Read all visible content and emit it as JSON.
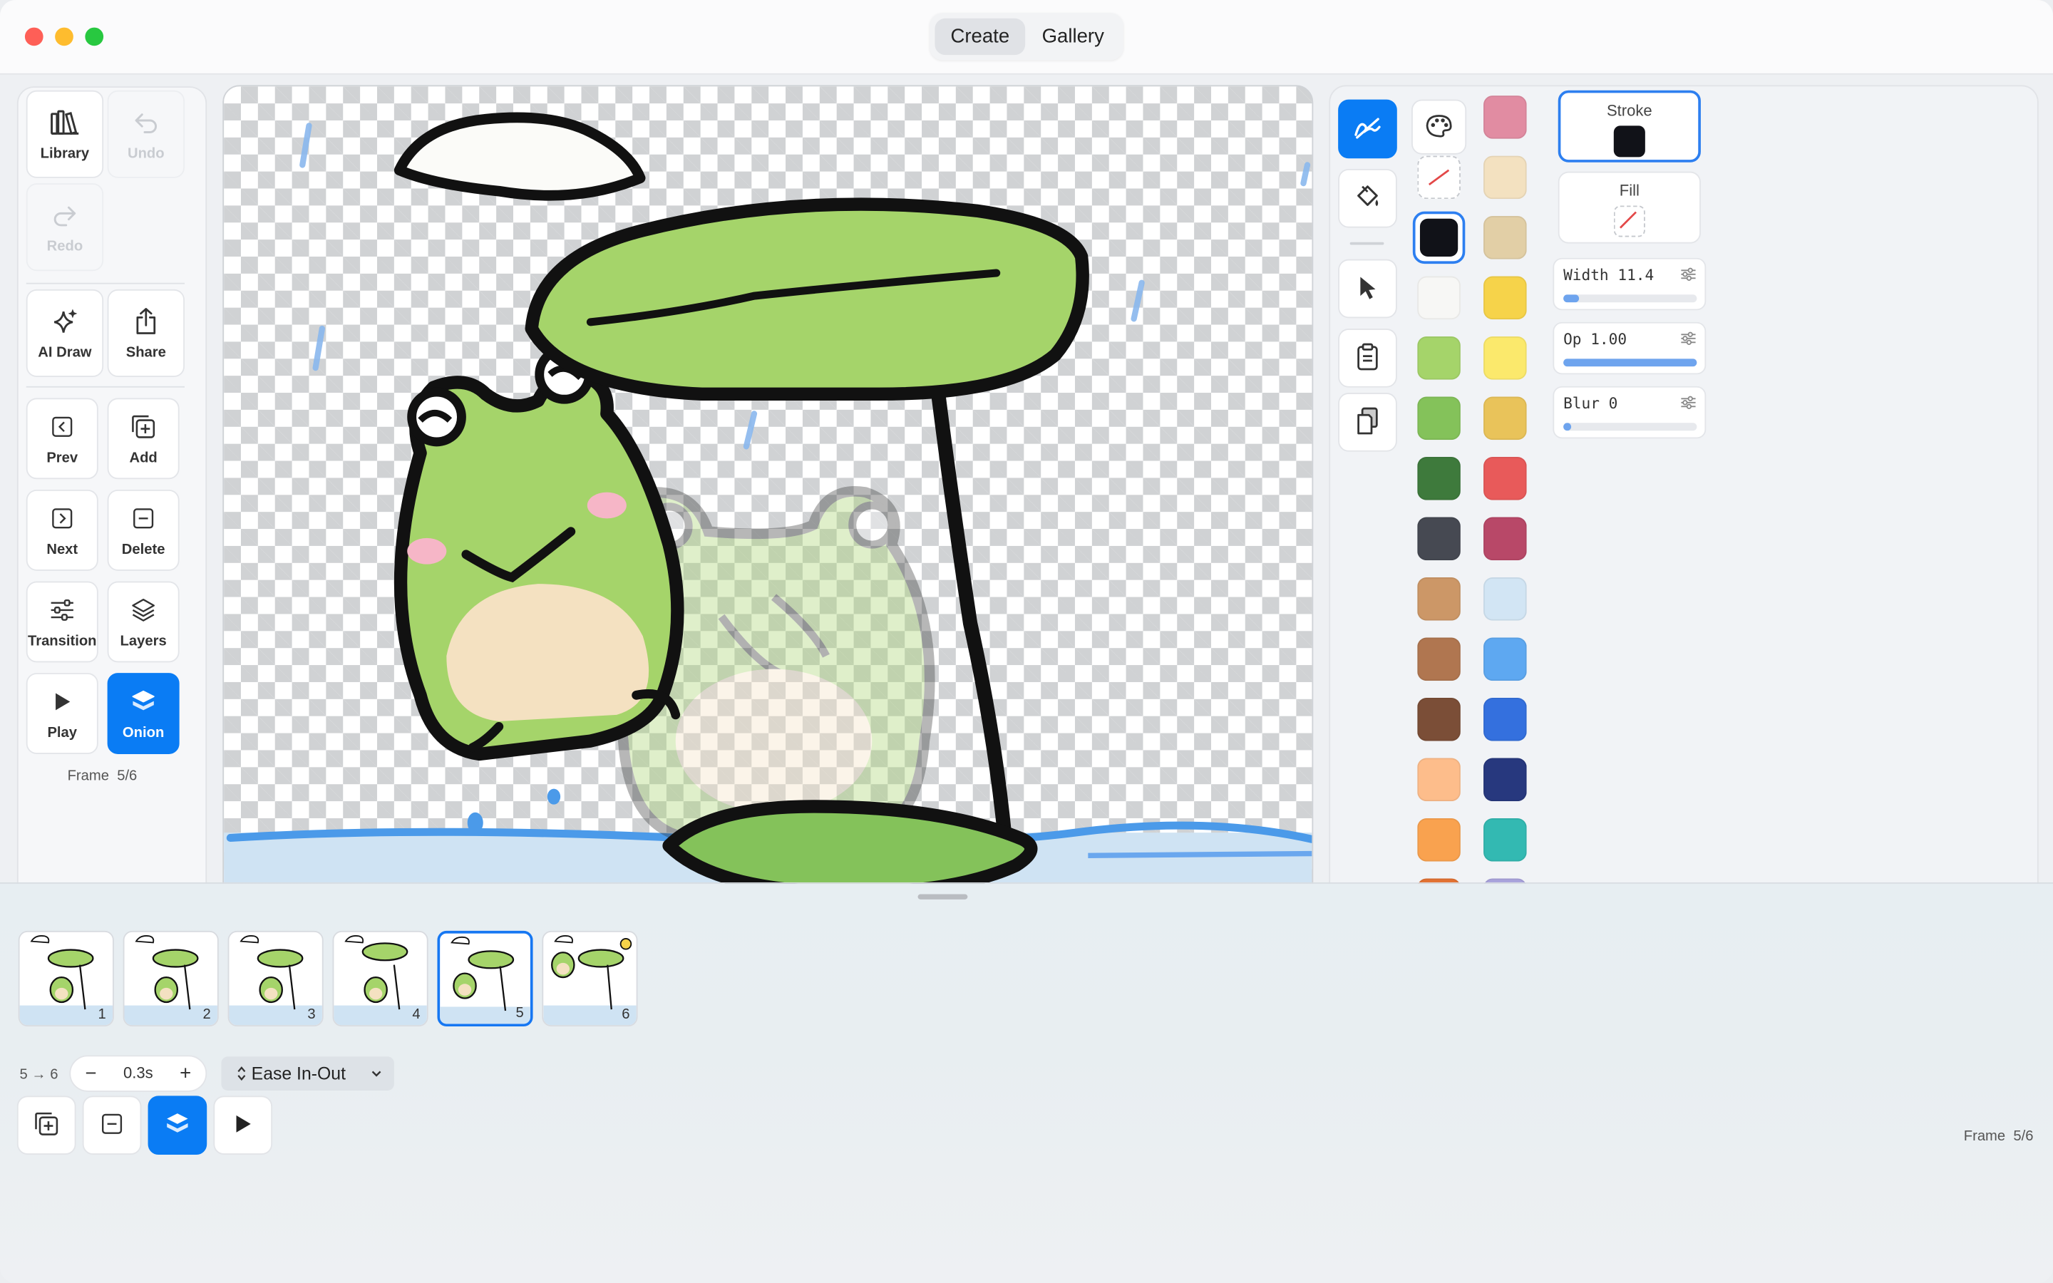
{
  "titlebar": {
    "tabs": [
      {
        "label": "Create",
        "active": true
      },
      {
        "label": "Gallery",
        "active": false
      }
    ]
  },
  "left_tools": {
    "library": "Library",
    "undo": "Undo",
    "redo": "Redo",
    "ai_draw": "AI Draw",
    "share": "Share",
    "prev": "Prev",
    "add": "Add",
    "next": "Next",
    "delete": "Delete",
    "transition": "Transition",
    "layers": "Layers",
    "play": "Play",
    "onion": "Onion",
    "frame_label": "Frame",
    "frame_value": "5/6"
  },
  "right_panel": {
    "tools": [
      "pen-icon",
      "palette-icon",
      "fill-bucket-icon",
      "pointer-icon",
      "clipboard-icon",
      "paste-icon"
    ],
    "swatches_col1": [
      "none",
      "#111218",
      "#f7f7f5",
      "#a5d46a",
      "#84c25a",
      "#3e7a3c",
      "#464952",
      "#cc9767",
      "#b07650",
      "#7b4e37",
      "#fdbd8b",
      "#f9a24f",
      "#e27132"
    ],
    "swatches_col2": [
      "#e18ca2",
      "#f3e1c0",
      "#e2cfa6",
      "#f6d34a",
      "#fbe96c",
      "#e9c35a",
      "#e85a5a",
      "#b84868",
      "#d2e5f4",
      "#5ea8f1",
      "#3470de",
      "#27387e",
      "#33b9b2",
      "#a9a3dc"
    ],
    "stroke": {
      "label": "Stroke",
      "color": "#111218"
    },
    "fill": {
      "label": "Fill",
      "color": "none"
    },
    "width": {
      "label": "Width 11.4",
      "value": 0.12
    },
    "opacity": {
      "label": "Op 1.00",
      "value": 1.0
    },
    "blur": {
      "label": "Blur 0",
      "value": 0.06
    }
  },
  "timeline": {
    "frames": [
      "1",
      "2",
      "3",
      "4",
      "5",
      "6"
    ],
    "selected_frame": 5,
    "transition_label": "5 → 6",
    "duration": "0.3s",
    "minus": "−",
    "plus": "+",
    "easing": "Ease In-Out",
    "frame_label": "Frame",
    "frame_value": "5/6"
  },
  "colors": {
    "accent": "#0a7cf4",
    "frog_green": "#a5d46a",
    "belly": "#f4e1c1",
    "water": "#cfe3f3"
  }
}
